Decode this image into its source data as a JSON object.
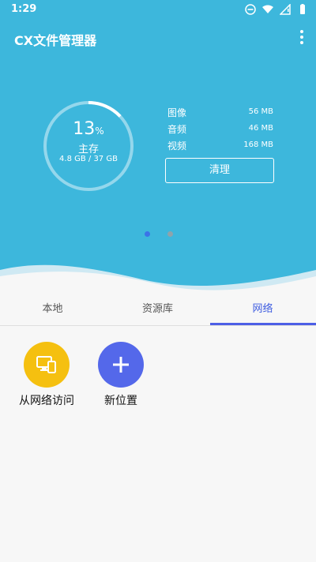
{
  "status_bar": {
    "time": "1:29",
    "icons": [
      "dnd-icon",
      "wifi-icon",
      "signal-icon",
      "battery-icon"
    ]
  },
  "app": {
    "title": "CX文件管理器"
  },
  "storage": {
    "percent": "13",
    "percent_sign": "%",
    "name": "主存",
    "size": "4.8 GB / 37 GB",
    "used_fraction": 0.13
  },
  "stats": [
    {
      "name": "图像",
      "value": "56 MB"
    },
    {
      "name": "音频",
      "value": "46 MB"
    },
    {
      "name": "视频",
      "value": "168 MB"
    }
  ],
  "clean_button": "清理",
  "page_indicator": {
    "active_index": 0,
    "count": 2
  },
  "tabs": [
    {
      "label": "本地",
      "active": false
    },
    {
      "label": "资源库",
      "active": false
    },
    {
      "label": "网络",
      "active": true
    }
  ],
  "network_items": [
    {
      "label": "从网络访问",
      "icon": "network-devices-icon",
      "color": "#f5c010"
    },
    {
      "label": "新位置",
      "icon": "plus-icon",
      "color": "#5468ea"
    }
  ],
  "colors": {
    "header": "#3db7dc",
    "accent": "#4d5fe6",
    "background": "#f7f7f7"
  }
}
